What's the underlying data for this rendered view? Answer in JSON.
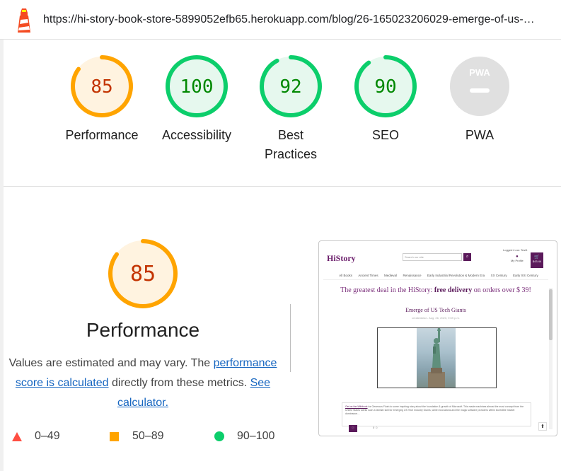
{
  "url_bar": {
    "url": "https://hi-story-book-store-5899052efb65.herokuapp.com/blog/26-165023206029-emerge-of-us-…"
  },
  "categories": [
    {
      "score": "85",
      "label": "Performance",
      "label_lines": [
        "Performance"
      ],
      "value": 85,
      "color": "#ffa400",
      "fill": "#fff3e0",
      "text_color": "#c33300"
    },
    {
      "score": "100",
      "label": "Accessibility",
      "label_lines": [
        "Accessibility"
      ],
      "value": 100,
      "color": "#0cce6b",
      "fill": "#e6f8ee",
      "text_color": "#008800"
    },
    {
      "score": "92",
      "label": "Best Practices",
      "label_lines": [
        "Best",
        "Practices"
      ],
      "value": 92,
      "color": "#0cce6b",
      "fill": "#e6f8ee",
      "text_color": "#008800"
    },
    {
      "score": "90",
      "label": "SEO",
      "label_lines": [
        "SEO"
      ],
      "value": 90,
      "color": "#0cce6b",
      "fill": "#e6f8ee",
      "text_color": "#008800"
    },
    {
      "score": "PWA",
      "label": "PWA",
      "label_lines": [
        "PWA"
      ],
      "value": null,
      "color": "#cccccc",
      "fill": "#e0e0e0",
      "text_color": "#ffffff"
    }
  ],
  "detail": {
    "score": "85",
    "value": 85,
    "title": "Performance",
    "desc_1": "Values are estimated and may vary. The",
    "desc_link": "performance score is calculated",
    "desc_2": " directly from these metrics. ",
    "desc_link_2": "See calculator.",
    "colors": {
      "fail": "#ff4e42",
      "average": "#ffa400",
      "pass": "#0cce6b"
    }
  },
  "legend": [
    {
      "range": "0–49",
      "shape": "triangle-icon"
    },
    {
      "range": "50–89",
      "shape": "square-icon"
    },
    {
      "range": "90–100",
      "shape": "circle-icon"
    }
  ],
  "screenshot": {
    "logo": "HiStory",
    "search_placeholder": "Search our site",
    "logged_in": "Logged in as: Test1",
    "profile_label": "My Profile",
    "cart_total": "$43.44",
    "nav": [
      "All Books",
      "Ancient Times",
      "Medieval",
      "Renaissance",
      "Early Industrial Revolution & Modern Era",
      "XX Century",
      "Early XXI Century"
    ],
    "banner_pre": "The greatest deal in the HiStory: ",
    "banner_bold": "free delivery",
    "banner_post": " on orders over $ 39!",
    "post_title": "Emerge of US Tech Giants",
    "post_date": "created/last - Aug. 26, 2023, 9:59 p.m.",
    "body_link": "Get on the Wikibook",
    "body_text": " for Generous Flush to some inspiring story about the foundation & growth of Microsoft. This made machines almost the most concept from the United States wants such a familiar skill for emerging US Tech Industry Giants, while innovations and the magic software providers within incredible market dominance…",
    "fav_icon": "♡",
    "count": "0 ☺"
  }
}
